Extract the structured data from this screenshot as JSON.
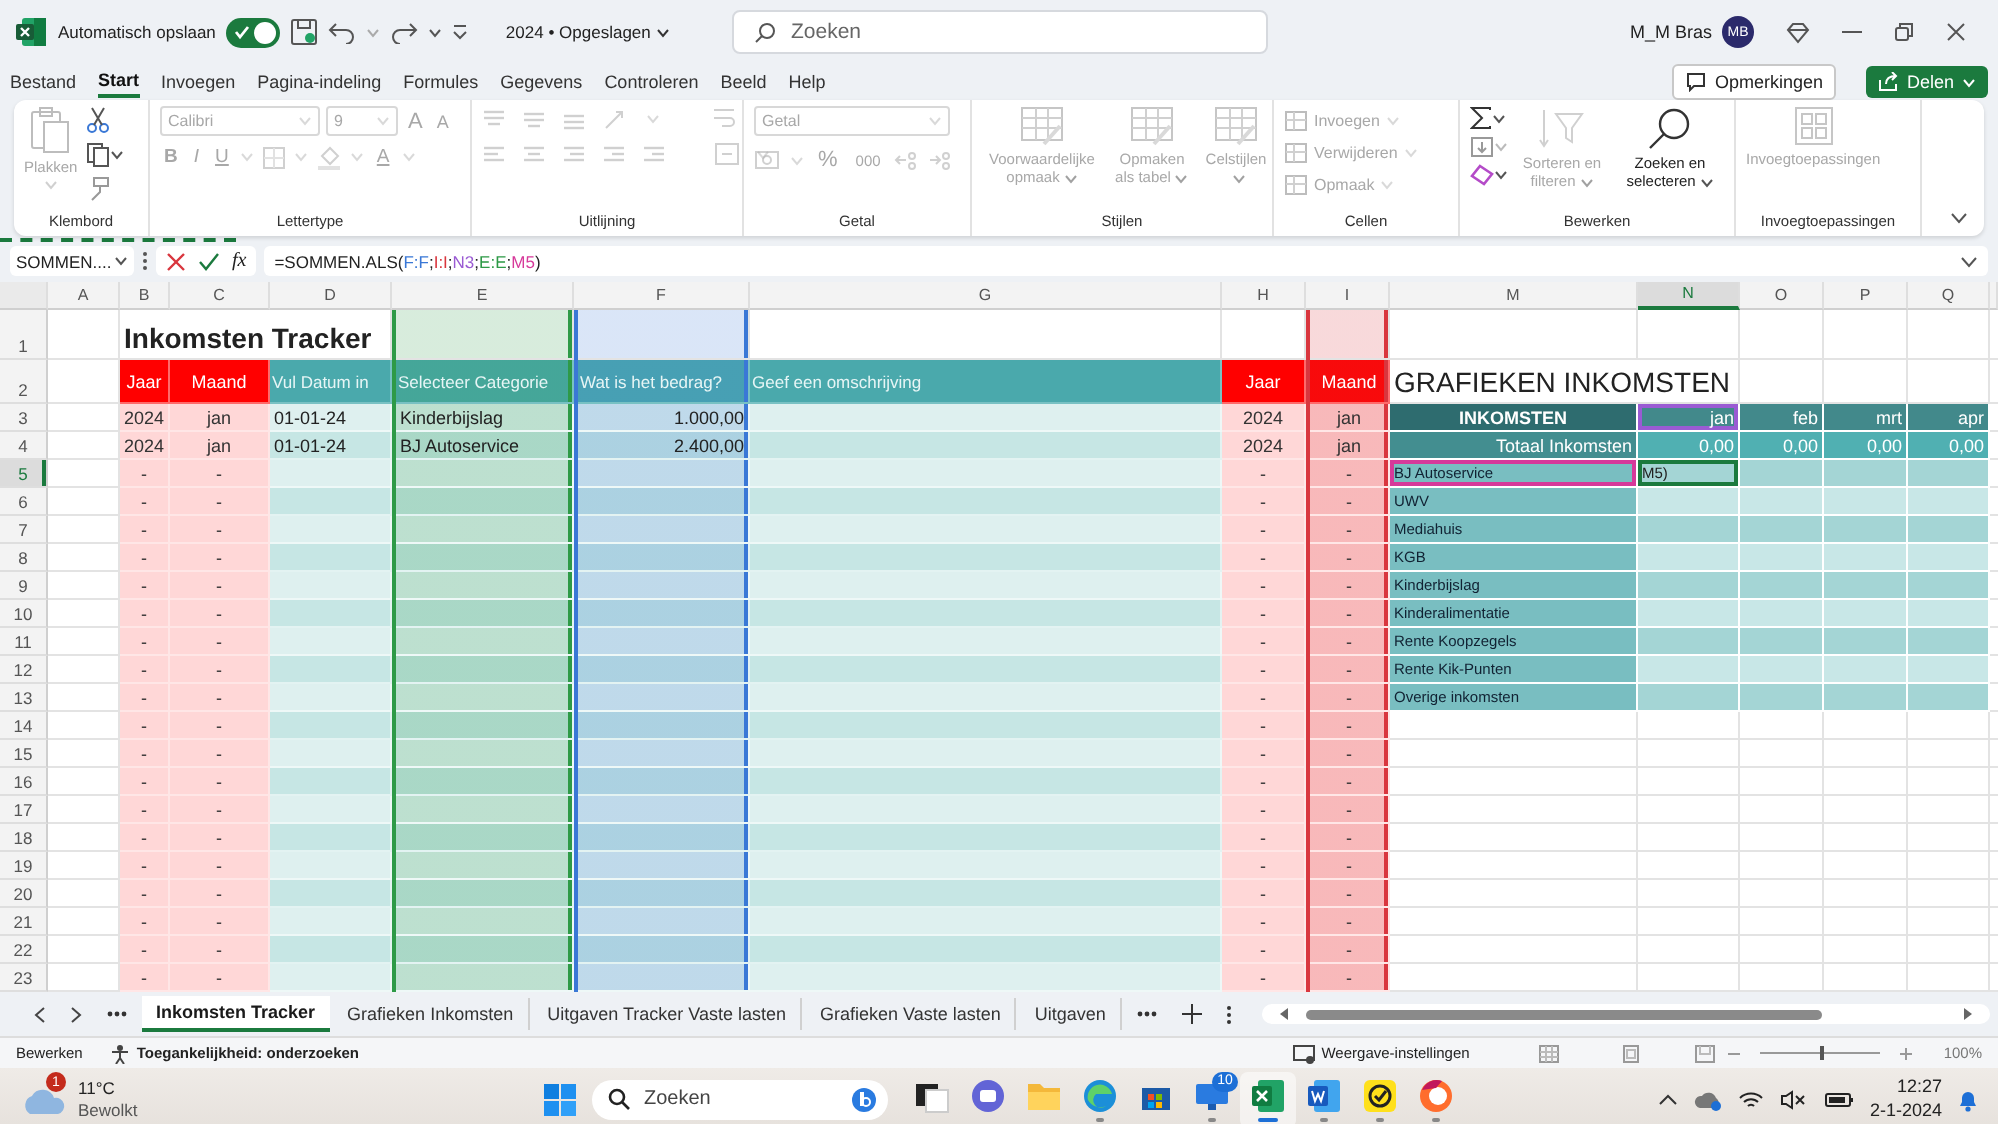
{
  "title_bar": {
    "autosave_label": "Automatisch opslaan",
    "autosave_on": true,
    "file_name": "2024 • Opgeslagen",
    "search": {
      "placeholder": "Zoeken"
    },
    "user_name": "M_M Bras",
    "avatar_initials": "MB"
  },
  "menu": {
    "tabs": [
      {
        "label": "Bestand",
        "selected": false
      },
      {
        "label": "Start",
        "selected": true
      },
      {
        "label": "Invoegen",
        "selected": false
      },
      {
        "label": "Pagina-indeling",
        "selected": false
      },
      {
        "label": "Formules",
        "selected": false
      },
      {
        "label": "Gegevens",
        "selected": false
      },
      {
        "label": "Controleren",
        "selected": false
      },
      {
        "label": "Beeld",
        "selected": false
      },
      {
        "label": "Help",
        "selected": false
      }
    ],
    "comments_button": "Opmerkingen",
    "share_button": "Delen"
  },
  "ribbon": {
    "groups": [
      {
        "label": "Klembord",
        "paste": "Plakken",
        "disabled": true
      },
      {
        "label": "Lettertype",
        "font": "Calibri",
        "size": "9",
        "size_buttons": [
          "A",
          "A"
        ],
        "style_buttons": [
          "B",
          "I",
          "U"
        ],
        "color_button": "A",
        "disabled": true
      },
      {
        "label": "Uitlijning",
        "disabled": true
      },
      {
        "label": "Getal",
        "format": "Getal",
        "buttons": [
          "%",
          "000"
        ],
        "disabled": true
      },
      {
        "label": "Stijlen",
        "commands": [
          {
            "label": "Voorwaardelijke opmaak",
            "disabled": true
          },
          {
            "label": "Opmaken als tabel",
            "disabled": true
          },
          {
            "label": "Celstijlen",
            "disabled": true
          }
        ]
      },
      {
        "label": "Cellen",
        "commands": [
          {
            "label": "Invoegen",
            "disabled": true
          },
          {
            "label": "Verwijderen",
            "disabled": true
          },
          {
            "label": "Opmaak",
            "disabled": true
          }
        ]
      },
      {
        "label": "Bewerken",
        "commands": [
          {
            "label": "Sorteren en filteren",
            "disabled": true
          },
          {
            "label": "Zoeken en selecteren",
            "disabled": false
          }
        ]
      },
      {
        "label": "Invoegtoepassingen",
        "commands": [
          {
            "label": "Invoegtoepassingen",
            "disabled": true
          }
        ]
      }
    ]
  },
  "formula_bar": {
    "name_box": "SOMMEN....",
    "fx": "fx",
    "parts": [
      {
        "text": "=SOMMEN.ALS("
      },
      {
        "text": "F:F",
        "color": "#3a78d6"
      },
      {
        "text": ";"
      },
      {
        "text": "I:I",
        "color": "#d9363e"
      },
      {
        "text": ";"
      },
      {
        "text": "N3",
        "color": "#9a5bd3"
      },
      {
        "text": ";"
      },
      {
        "text": "E:E",
        "color": "#2e9a47"
      },
      {
        "text": ";"
      },
      {
        "text": "M5",
        "color": "#d6399a"
      },
      {
        "text": ")"
      }
    ]
  },
  "sheet": {
    "columns": [
      {
        "letter": "A",
        "kind": "blank"
      },
      {
        "letter": "B",
        "kind": "year"
      },
      {
        "letter": "C",
        "kind": "month"
      },
      {
        "letter": "D",
        "kind": "date"
      },
      {
        "letter": "E",
        "kind": "category",
        "color": "#2e9a47"
      },
      {
        "letter": "F",
        "kind": "amount",
        "color": "#3a78d6"
      },
      {
        "letter": "G",
        "kind": "text"
      },
      {
        "letter": "H",
        "kind": "year"
      },
      {
        "letter": "I",
        "kind": "month",
        "color": "#d9363e"
      },
      {
        "letter": "M",
        "kind": "label"
      },
      {
        "letter": "N",
        "kind": "value"
      },
      {
        "letter": "O",
        "kind": "value"
      },
      {
        "letter": "P",
        "kind": "value"
      },
      {
        "letter": "Q",
        "kind": "value"
      }
    ],
    "rows": [
      {
        "number": "1",
        "left": {
          "kind": "title",
          "cells": {
            "B": "Inkomsten Tracker"
          }
        },
        "right": {
          "kind": "blank"
        }
      },
      {
        "number": "2",
        "left": {
          "kind": "header",
          "cells": {
            "B": "Jaar",
            "C": "Maand",
            "D": "Vul Datum in",
            "E": "Selecteer Categorie",
            "F": "Wat is het bedrag?",
            "G": "Geef een omschrijving",
            "H": "Jaar",
            "I": "Maand"
          }
        },
        "right": {
          "kind": "title",
          "cells": {
            "M": "GRAFIEKEN INKOMSTEN"
          }
        }
      },
      {
        "number": "3",
        "left": {
          "kind": "data",
          "cells": {
            "B": "2024",
            "C": "jan",
            "D": "01-01-24",
            "E": "Kinderbijslag",
            "F": "1.000,00",
            "H": "2024",
            "I": "jan"
          }
        },
        "right": {
          "kind": "header",
          "cells": {
            "M": "INKOMSTEN",
            "N": "jan",
            "O": "feb",
            "P": "mrt",
            "Q": "apr"
          },
          "outline": {
            "N": {
              "color": "#9a5bd3"
            }
          }
        }
      },
      {
        "number": "4",
        "left": {
          "kind": "data",
          "cells": {
            "B": "2024",
            "C": "jan",
            "D": "01-01-24",
            "E": "BJ Autoservice",
            "F": "2.400,00",
            "H": "2024",
            "I": "jan"
          }
        },
        "right": {
          "kind": "total",
          "cells": {
            "M": "Totaal Inkomsten",
            "N": "0,00",
            "O": "0,00",
            "P": "0,00",
            "Q": "0,00"
          }
        }
      },
      {
        "number": "5",
        "left": {
          "kind": "data",
          "cells": {
            "B": "-",
            "C": "-",
            "H": "-",
            "I": "-"
          }
        },
        "right": {
          "kind": "item",
          "cells": {
            "M": "BJ Autoservice",
            "N": "M5)"
          },
          "outline": {
            "M": {
              "color": "#d6399a"
            }
          },
          "selected": {
            "N": true
          }
        }
      },
      {
        "number": "6",
        "left": {
          "kind": "data",
          "cells": {
            "B": "-",
            "C": "-",
            "H": "-",
            "I": "-"
          }
        },
        "right": {
          "kind": "item",
          "cells": {
            "M": "UWV"
          }
        }
      },
      {
        "number": "7",
        "left": {
          "kind": "data",
          "cells": {
            "B": "-",
            "C": "-",
            "H": "-",
            "I": "-"
          }
        },
        "right": {
          "kind": "item",
          "cells": {
            "M": "Mediahuis"
          }
        }
      },
      {
        "number": "8",
        "left": {
          "kind": "data",
          "cells": {
            "B": "-",
            "C": "-",
            "H": "-",
            "I": "-"
          }
        },
        "right": {
          "kind": "item",
          "cells": {
            "M": "KGB"
          }
        }
      },
      {
        "number": "9",
        "left": {
          "kind": "data",
          "cells": {
            "B": "-",
            "C": "-",
            "H": "-",
            "I": "-"
          }
        },
        "right": {
          "kind": "item",
          "cells": {
            "M": "Kinderbijslag"
          }
        }
      },
      {
        "number": "10",
        "left": {
          "kind": "data",
          "cells": {
            "B": "-",
            "C": "-",
            "H": "-",
            "I": "-"
          }
        },
        "right": {
          "kind": "item",
          "cells": {
            "M": "Kinderalimentatie"
          }
        }
      },
      {
        "number": "11",
        "left": {
          "kind": "data",
          "cells": {
            "B": "-",
            "C": "-",
            "H": "-",
            "I": "-"
          }
        },
        "right": {
          "kind": "item",
          "cells": {
            "M": "Rente Koopzegels"
          }
        }
      },
      {
        "number": "12",
        "left": {
          "kind": "data",
          "cells": {
            "B": "-",
            "C": "-",
            "H": "-",
            "I": "-"
          }
        },
        "right": {
          "kind": "item",
          "cells": {
            "M": "Rente Kik-Punten"
          }
        }
      },
      {
        "number": "13",
        "left": {
          "kind": "data",
          "cells": {
            "B": "-",
            "C": "-",
            "H": "-",
            "I": "-"
          }
        },
        "right": {
          "kind": "item",
          "cells": {
            "M": "Overige inkomsten"
          }
        }
      },
      {
        "number": "14",
        "left": {
          "kind": "data",
          "cells": {
            "B": "-",
            "C": "-",
            "H": "-",
            "I": "-"
          }
        },
        "right": {
          "kind": "blank"
        }
      },
      {
        "number": "15",
        "left": {
          "kind": "data",
          "cells": {
            "B": "-",
            "C": "-",
            "H": "-",
            "I": "-"
          }
        },
        "right": {
          "kind": "blank"
        }
      },
      {
        "number": "16",
        "left": {
          "kind": "data",
          "cells": {
            "B": "-",
            "C": "-",
            "H": "-",
            "I": "-"
          }
        },
        "right": {
          "kind": "blank"
        }
      },
      {
        "number": "17",
        "left": {
          "kind": "data",
          "cells": {
            "B": "-",
            "C": "-",
            "H": "-",
            "I": "-"
          }
        },
        "right": {
          "kind": "blank"
        }
      },
      {
        "number": "18",
        "left": {
          "kind": "data",
          "cells": {
            "B": "-",
            "C": "-",
            "H": "-",
            "I": "-"
          }
        },
        "right": {
          "kind": "blank"
        }
      },
      {
        "number": "19",
        "left": {
          "kind": "data",
          "cells": {
            "B": "-",
            "C": "-",
            "H": "-",
            "I": "-"
          }
        },
        "right": {
          "kind": "blank"
        }
      },
      {
        "number": "20",
        "left": {
          "kind": "data",
          "cells": {
            "B": "-",
            "C": "-",
            "H": "-",
            "I": "-"
          }
        },
        "right": {
          "kind": "blank"
        }
      },
      {
        "number": "21",
        "left": {
          "kind": "data",
          "cells": {
            "B": "-",
            "C": "-",
            "H": "-",
            "I": "-"
          }
        },
        "right": {
          "kind": "blank"
        }
      },
      {
        "number": "22",
        "left": {
          "kind": "data",
          "cells": {
            "B": "-",
            "C": "-",
            "H": "-",
            "I": "-"
          }
        },
        "right": {
          "kind": "blank"
        }
      },
      {
        "number": "23",
        "left": {
          "kind": "data",
          "cells": {
            "B": "-",
            "C": "-",
            "H": "-",
            "I": "-"
          }
        },
        "right": {
          "kind": "blank"
        }
      }
    ]
  },
  "sheet_tabs": [
    {
      "label": "Inkomsten Tracker",
      "selected": true
    },
    {
      "label": "Grafieken Inkomsten",
      "selected": false
    },
    {
      "label": "Uitgaven Tracker Vaste lasten",
      "selected": false
    },
    {
      "label": "Grafieken Vaste lasten",
      "selected": false
    },
    {
      "label": "Uitgaven",
      "selected": false
    }
  ],
  "status_bar": {
    "mode": "Bewerken",
    "accessibility": "Toegankelijkheid: onderzoeken",
    "display_settings": "Weergave-instellingen",
    "zoom": {
      "level": 0.5,
      "reading": "100%"
    }
  },
  "taskbar": {
    "weather": {
      "temperature": "11°C",
      "condition": "Bewolkt",
      "badge": "1"
    },
    "search": {
      "placeholder": "Zoeken"
    },
    "apps": [
      {
        "running": false,
        "active": false
      },
      {
        "running": false,
        "active": false
      },
      {
        "running": false,
        "active": false
      },
      {
        "running": true,
        "active": false
      },
      {
        "running": false,
        "active": false
      },
      {
        "running": true,
        "active": false,
        "badge": "10"
      },
      {
        "running": true,
        "active": true
      },
      {
        "running": true,
        "active": false
      },
      {
        "running": true,
        "active": false
      },
      {
        "running": true,
        "active": false
      }
    ],
    "time": "12:27",
    "date": "2-1-2024"
  }
}
